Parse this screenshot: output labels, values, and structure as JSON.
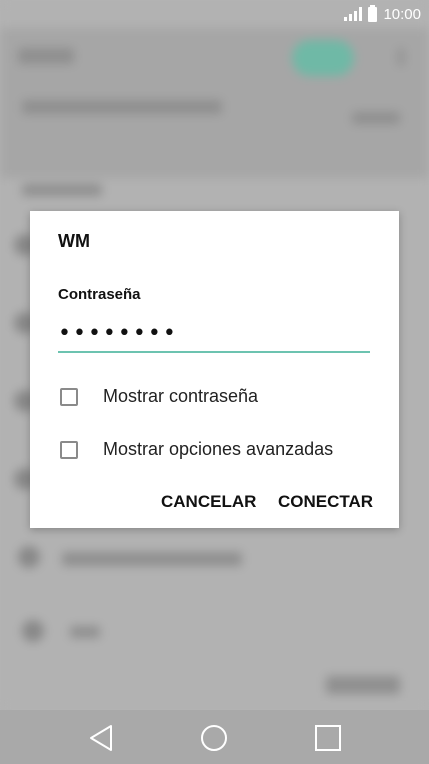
{
  "status_bar": {
    "time": "10:00",
    "signal_icon": "signal-icon",
    "battery_icon": "battery-icon"
  },
  "dialog": {
    "title": "WM",
    "password_label": "Contraseña",
    "password_value": "••••••••",
    "show_password_label": "Mostrar contraseña",
    "show_password_checked": false,
    "advanced_options_label": "Mostrar opciones avanzadas",
    "advanced_options_checked": false,
    "cancel_label": "CANCELAR",
    "connect_label": "CONECTAR",
    "accent_color": "#6cc3b0"
  },
  "nav_bar": {
    "back_icon": "back-icon",
    "home_icon": "home-icon",
    "recents_icon": "recents-icon"
  }
}
